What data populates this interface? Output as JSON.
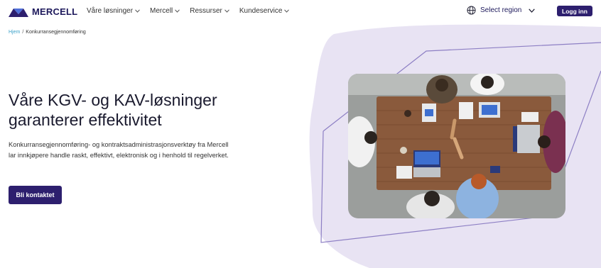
{
  "brand": {
    "name": "MERCELL"
  },
  "nav": {
    "items": [
      {
        "label": "Våre løsninger"
      },
      {
        "label": "Mercell"
      },
      {
        "label": "Ressurser"
      },
      {
        "label": "Kundeservice"
      }
    ]
  },
  "region": {
    "label": "Select region"
  },
  "login": {
    "label": "Logg inn"
  },
  "breadcrumb": {
    "home": "Hjem",
    "separator": "/",
    "current": "Konkurransegjennomføring"
  },
  "hero": {
    "title_line1": "Våre KGV- og KAV-løsninger",
    "title_line2": "garanterer effektivitet",
    "desc_line1": "Konkurransegjennomføring- og kontraktsadministrasjonsverktøy fra Mercell",
    "desc_line2": "lar innkjøpere handle raskt, effektivt, elektronisk og i henhold til regelverket.",
    "cta": "Bli kontaktet"
  },
  "colors": {
    "brand_dark": "#2d1f6e",
    "blob": "#e8e3f3",
    "outline": "#8d7fc4",
    "link": "#3aa0c8"
  }
}
